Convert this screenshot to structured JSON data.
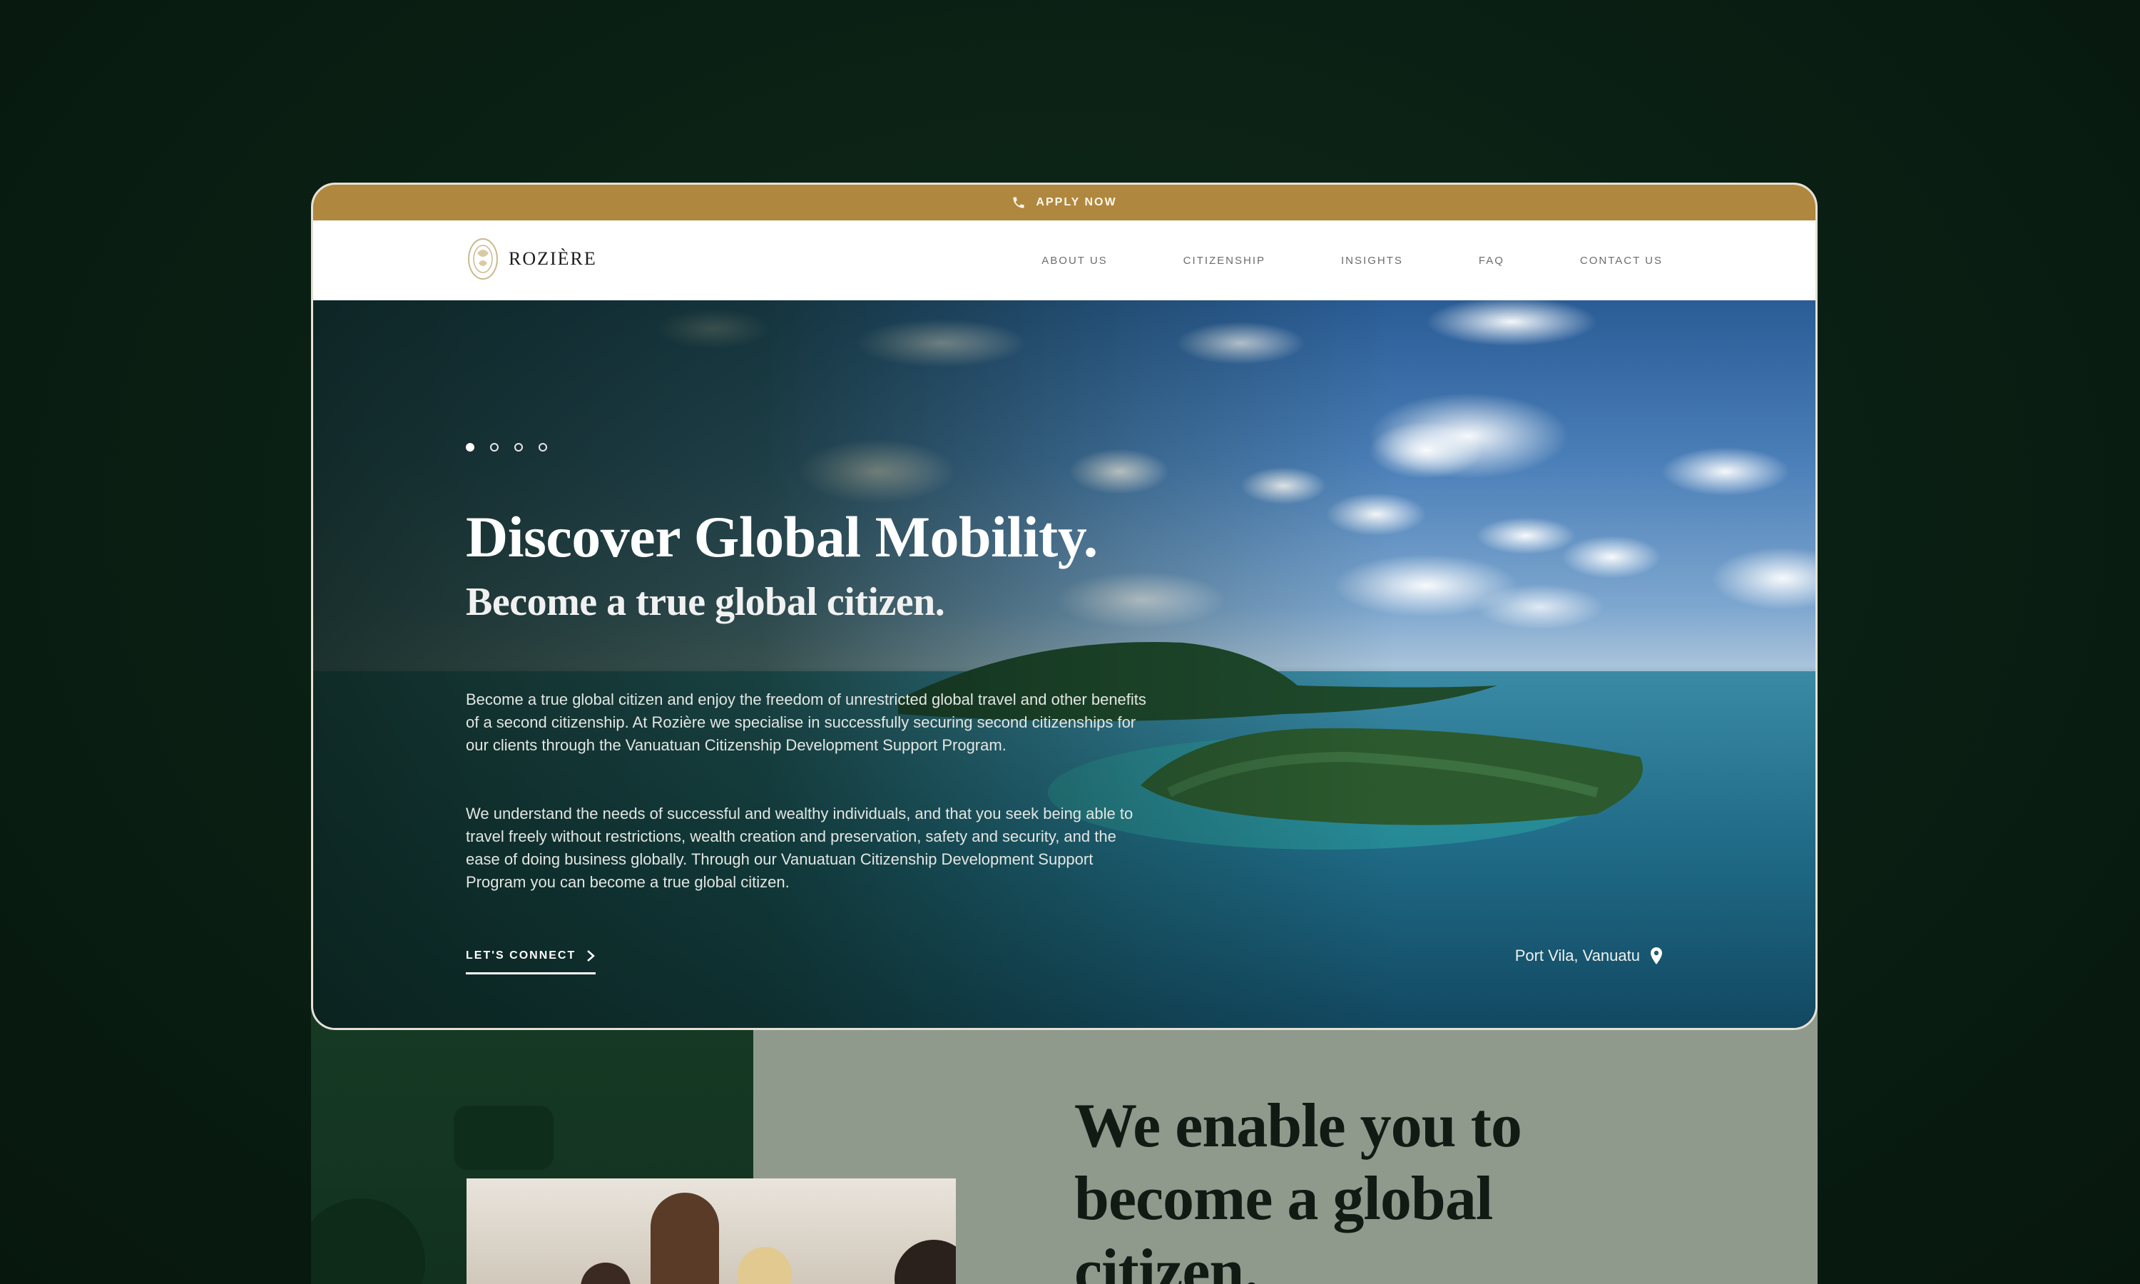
{
  "topbar": {
    "apply_label": "APPLY NOW",
    "icon": "phone-icon",
    "background": "#b0873e"
  },
  "brand": {
    "name": "ROZIÈRE",
    "logo_icon": "crest-logo-icon"
  },
  "nav": {
    "items": [
      {
        "label": "ABOUT US"
      },
      {
        "label": "CITIZENSHIP"
      },
      {
        "label": "INSIGHTS"
      },
      {
        "label": "FAQ"
      },
      {
        "label": "CONTACT US"
      }
    ]
  },
  "hero": {
    "slides": {
      "count": 4,
      "active_index": 0
    },
    "title": "Discover Global Mobility.",
    "subtitle": "Become a true global citizen.",
    "paragraphs": [
      "Become a true global citizen and enjoy the freedom of unrestricted global travel and other benefits of a second citizenship. At Rozière we specialise in successfully securing second citizenships for our clients through the Vanuatuan Citizenship Development Support Program.",
      "We understand the needs of successful and wealthy individuals, and that you seek being able to travel freely without restrictions, wealth creation and preservation, safety and security, and the ease of doing business globally. Through our Vanuatuan Citizenship Development Support Program you can become a true global citizen."
    ],
    "cta_label": "LET'S CONNECT",
    "cta_icon": "chevron-right-icon",
    "location": "Port Vila, Vanuatu",
    "location_icon": "map-pin-icon"
  },
  "section2": {
    "heading": "We enable you to become a global citizen."
  },
  "colors": {
    "page_background": "#0a1f13",
    "accent_gold": "#b0873e",
    "lower_panel": "#8f9a8d"
  }
}
